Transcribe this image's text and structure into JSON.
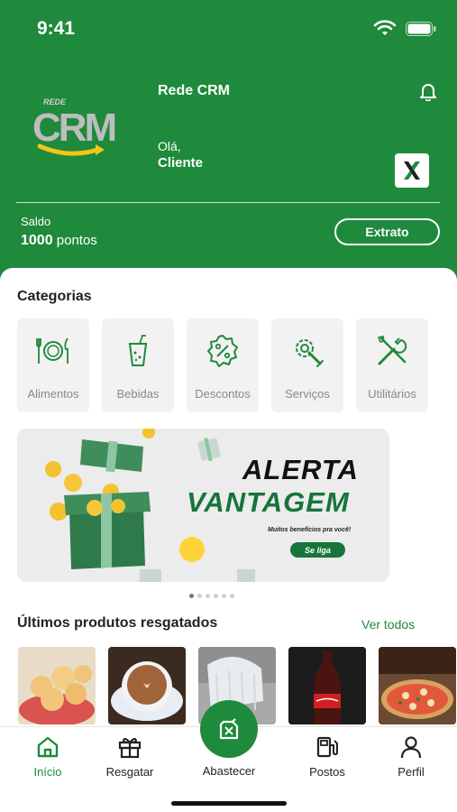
{
  "status_bar": {
    "time": "9:41",
    "icons": [
      "wifi-icon",
      "battery-icon"
    ]
  },
  "header": {
    "logo_text_small": "REDE",
    "logo_text_big": "CRM",
    "app_name": "Rede CRM",
    "greeting": "Olá,",
    "user_name": "Cliente",
    "partner_badge_letter": "X",
    "balance_label": "Saldo",
    "balance_points": "1000",
    "balance_unit": "pontos",
    "extrato_label": "Extrato",
    "bell_icon": "bell-icon"
  },
  "categories": {
    "title": "Categorias",
    "items": [
      {
        "label": "Alimentos",
        "icon": "plate-cutlery-icon"
      },
      {
        "label": "Bebidas",
        "icon": "drink-cup-icon"
      },
      {
        "label": "Descontos",
        "icon": "discount-badge-icon"
      },
      {
        "label": "Serviços",
        "icon": "gear-wrench-icon"
      },
      {
        "label": "Utilitários",
        "icon": "tools-icon"
      }
    ]
  },
  "banner": {
    "title_line1": "ALERTA",
    "title_line2": "VANTAGEM",
    "subtitle": "Muitos benefícios pra você!",
    "cta": "Se liga"
  },
  "carousel": {
    "count": 6,
    "active_index": 0
  },
  "recent": {
    "title": "Últimos produtos resgatados",
    "see_all": "Ver todos",
    "products": [
      {
        "name": "pao-de-queijo"
      },
      {
        "name": "cafe"
      },
      {
        "name": "lavagem"
      },
      {
        "name": "refrigerante"
      },
      {
        "name": "pizza"
      }
    ]
  },
  "nav": {
    "items": [
      {
        "label": "Início",
        "icon": "home-icon",
        "active": true
      },
      {
        "label": "Resgatar",
        "icon": "gift-icon",
        "active": false
      },
      {
        "label": "Abastecer",
        "icon": "fuel-can-icon",
        "active": false
      },
      {
        "label": "Postos",
        "icon": "gas-station-icon",
        "active": false
      },
      {
        "label": "Perfil",
        "icon": "user-icon",
        "active": false
      }
    ]
  },
  "colors": {
    "primary": "#1f8a3c",
    "banner_green": "#16753a",
    "card_bg": "#f2f2f2"
  }
}
